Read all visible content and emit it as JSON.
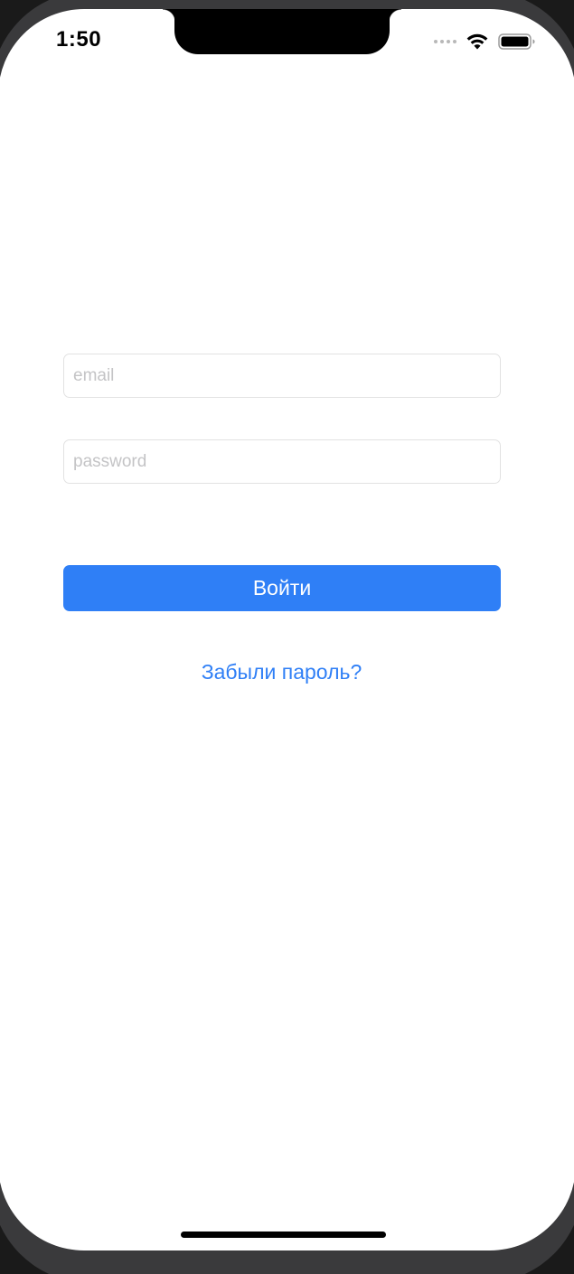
{
  "status_bar": {
    "time": "1:50",
    "wifi_icon": "wifi-icon",
    "battery_icon": "battery-icon",
    "cellular_icon": "cellular-signal-icon"
  },
  "login_form": {
    "email": {
      "placeholder": "email",
      "value": ""
    },
    "password": {
      "placeholder": "password",
      "value": ""
    },
    "submit_label": "Войти",
    "forgot_password_label": "Забыли пароль?"
  },
  "colors": {
    "accent": "#2f7ff6",
    "background": "#ffffff",
    "field_border": "#e2e2e2",
    "placeholder": "#c4c4c6"
  }
}
